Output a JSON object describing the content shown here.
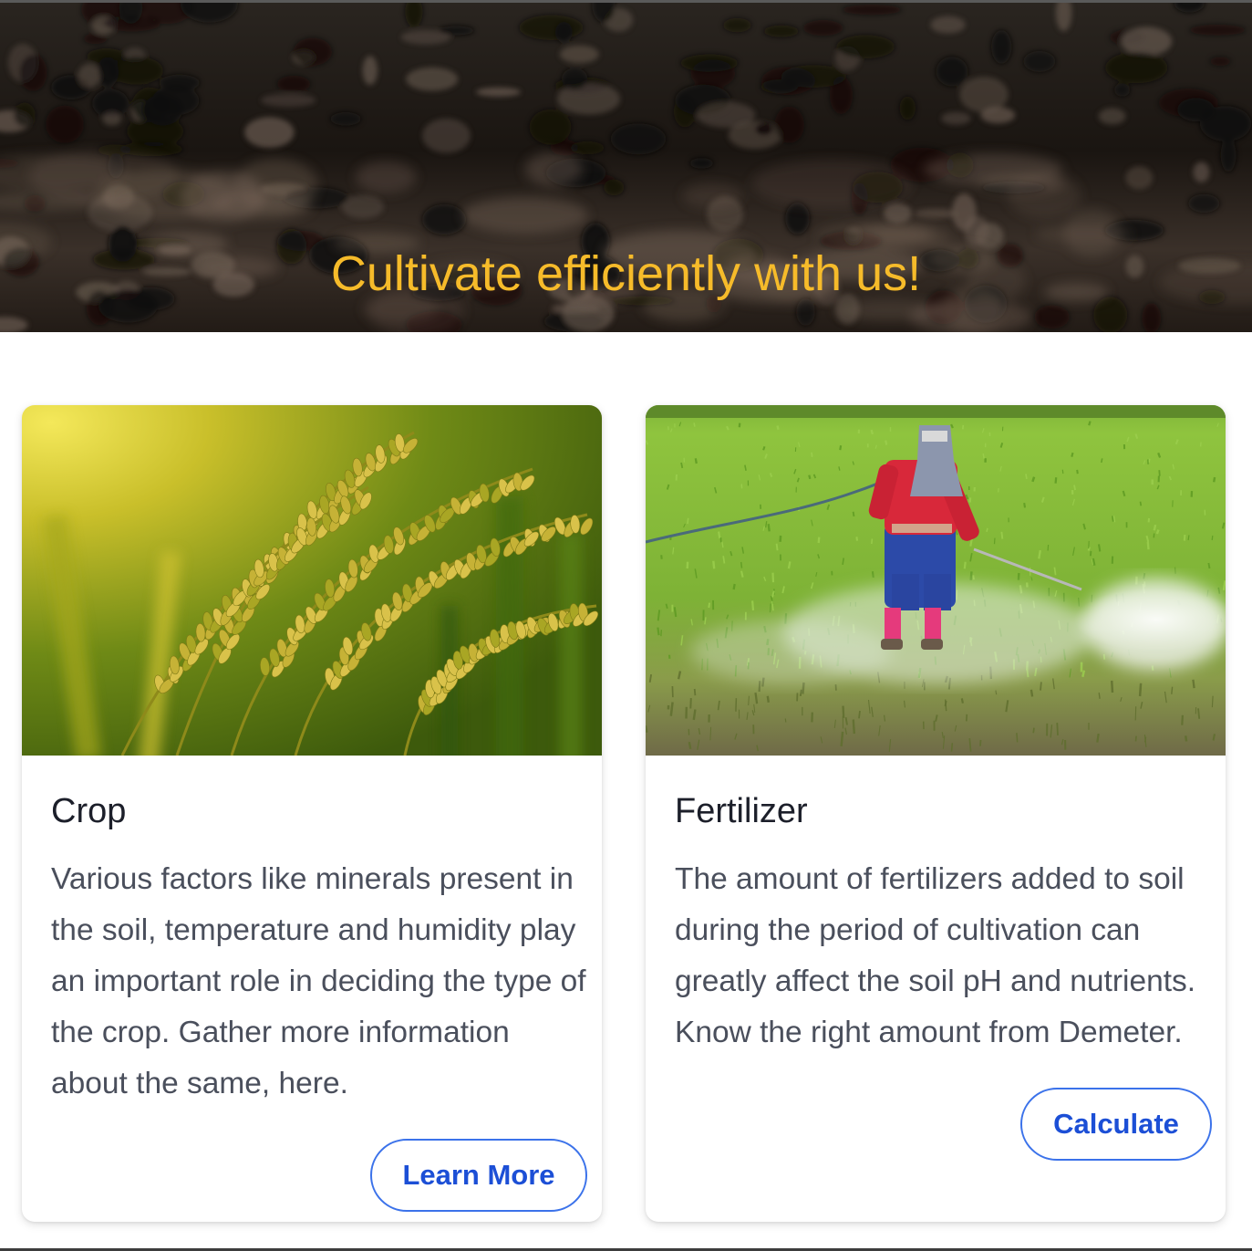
{
  "hero": {
    "title": "Cultivate efficiently with us!",
    "title_color": "#f6bb2a",
    "background": "dark-soil-photo"
  },
  "cards": [
    {
      "id": "crop",
      "image": "rice-grain-stalks-photo",
      "title": "Crop",
      "description": "Various factors like minerals present in the soil, temperature and humidity play an important role in deciding the type of the crop. Gather more information about the same, here.",
      "button_label": "Learn More"
    },
    {
      "id": "fertilizer",
      "image": "farmer-spraying-field-photo",
      "title": "Fertilizer",
      "description": "The amount of fertilizers added to soil during the period of cultivation can greatly affect the soil pH and nutrients. Know the right amount from Demeter.",
      "button_label": "Calculate"
    }
  ],
  "colors": {
    "accent": "#1c4fd6",
    "button_border": "#3b72ea",
    "heading": "#1c1f2a",
    "body_text": "#4a4f5c"
  }
}
